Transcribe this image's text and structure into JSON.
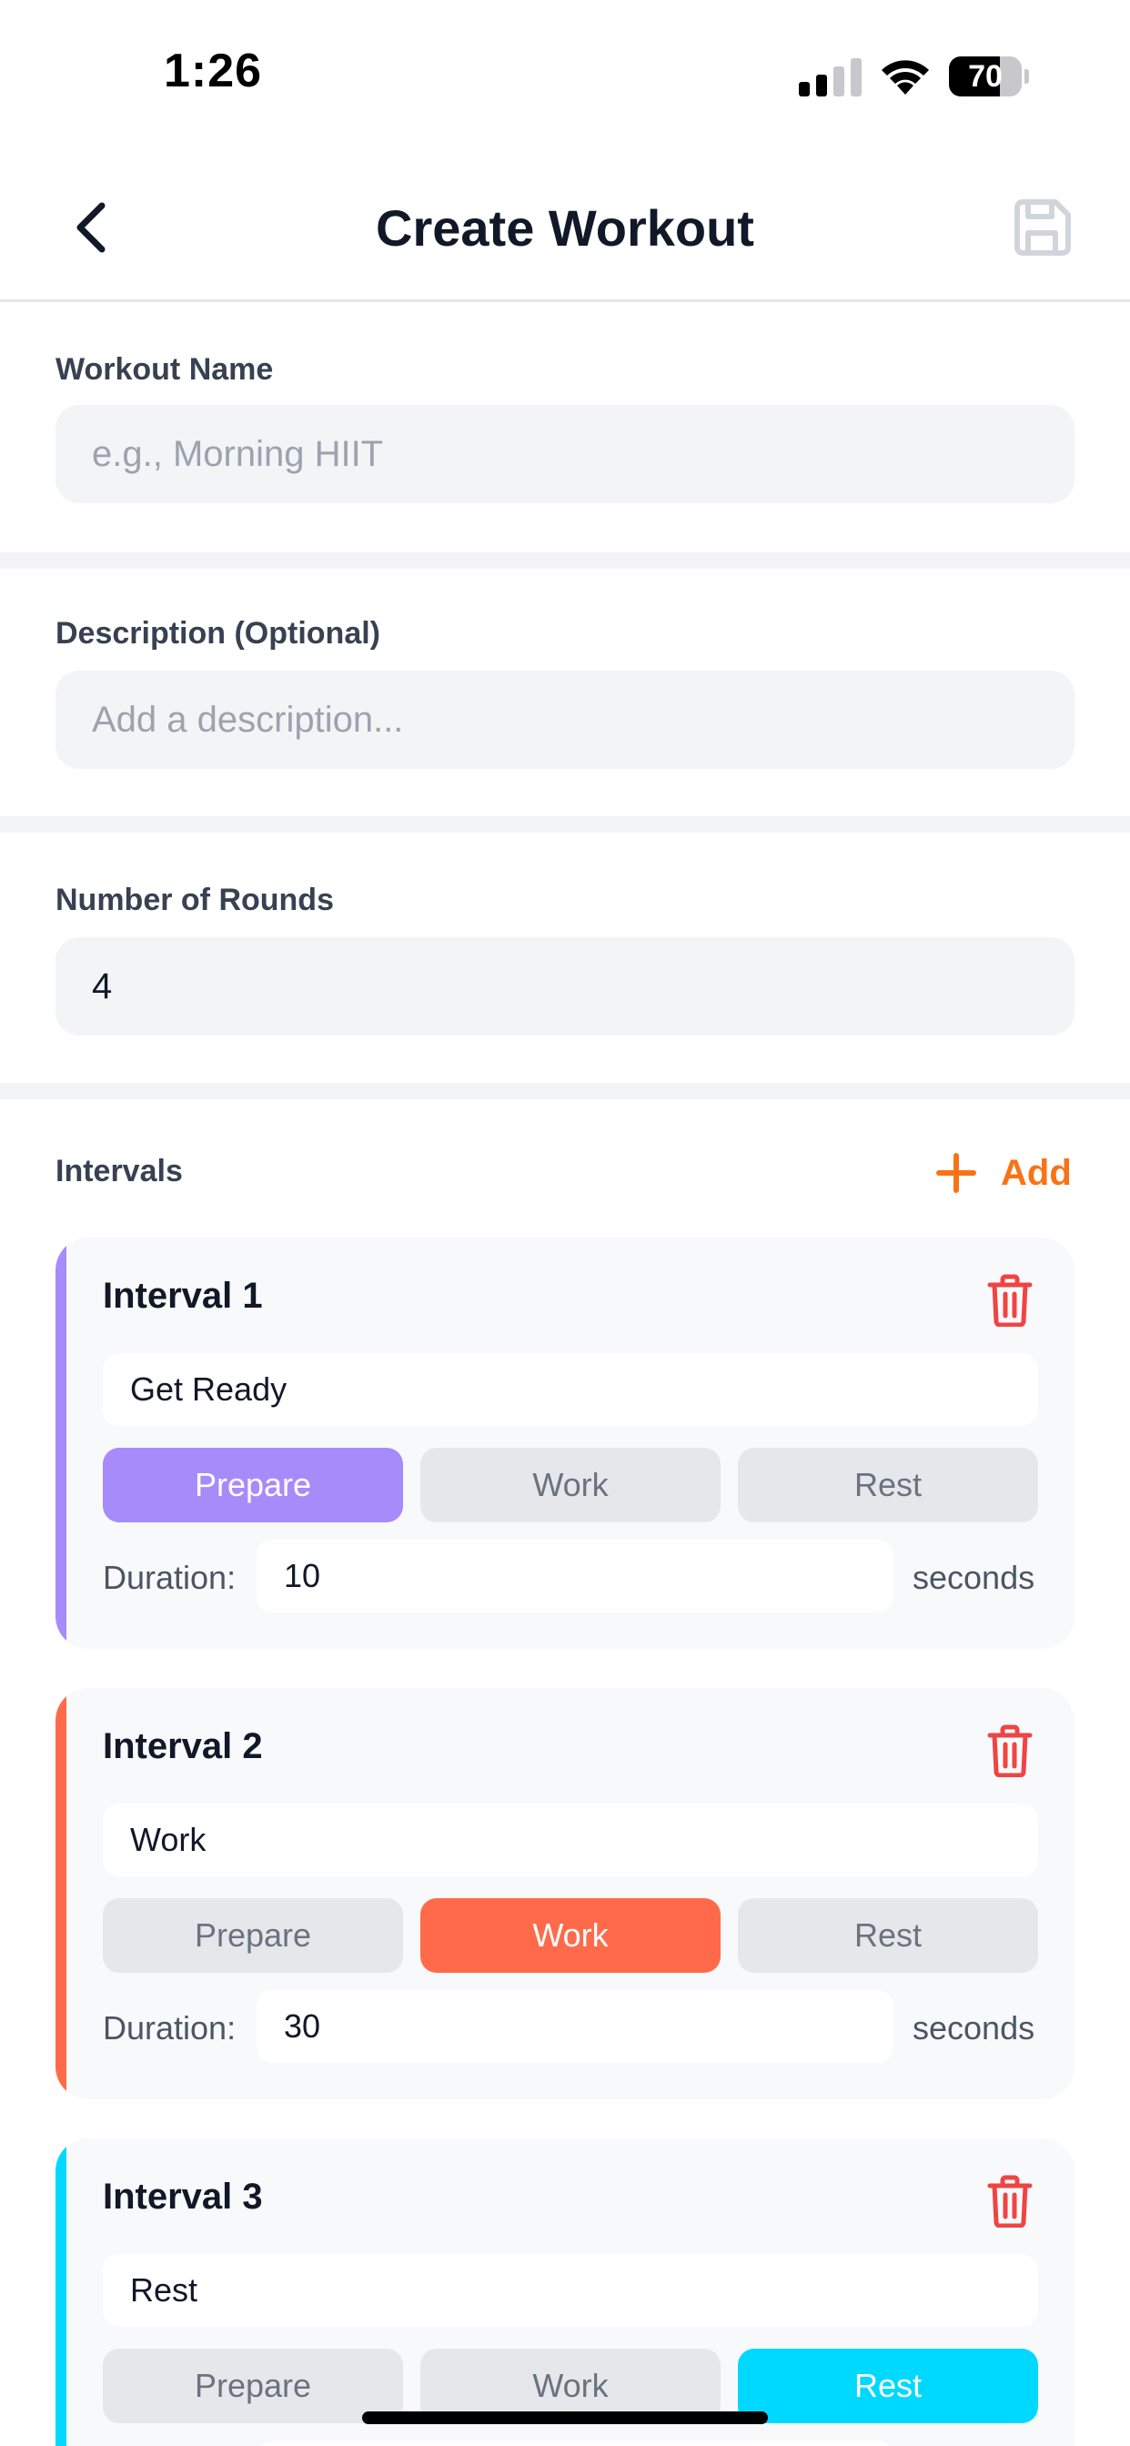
{
  "status_bar": {
    "time": "1:26",
    "battery_level": "70",
    "battery_fraction": 0.7
  },
  "nav": {
    "title": "Create Workout",
    "back_icon": "chevron-left-icon",
    "save_icon": "floppy-disk-icon"
  },
  "form": {
    "name": {
      "label": "Workout Name",
      "placeholder": "e.g., Morning HIIT",
      "value": ""
    },
    "description": {
      "label": "Description (Optional)",
      "placeholder": "Add a description...",
      "value": ""
    },
    "rounds": {
      "label": "Number of Rounds",
      "value": "4"
    }
  },
  "intervals": {
    "label": "Intervals",
    "add_label": "Add",
    "add_icon": "plus-icon",
    "delete_icon": "trash-icon",
    "type_options": [
      "Prepare",
      "Work",
      "Rest"
    ],
    "duration_label": "Duration:",
    "duration_unit": "seconds",
    "items": [
      {
        "title": "Interval 1",
        "name": "Get Ready",
        "type": "Prepare",
        "duration": "10",
        "color": "#a78bfa"
      },
      {
        "title": "Interval 2",
        "name": "Work",
        "type": "Work",
        "duration": "30",
        "color": "#ff6b4a"
      },
      {
        "title": "Interval 3",
        "name": "Rest",
        "type": "Rest",
        "duration": "",
        "color": "#00d9ff"
      }
    ]
  },
  "colors": {
    "accent": "#f97316",
    "delete": "#ef4444",
    "field_bg": "#f3f4f6",
    "card_bg": "#f8f9fb"
  }
}
